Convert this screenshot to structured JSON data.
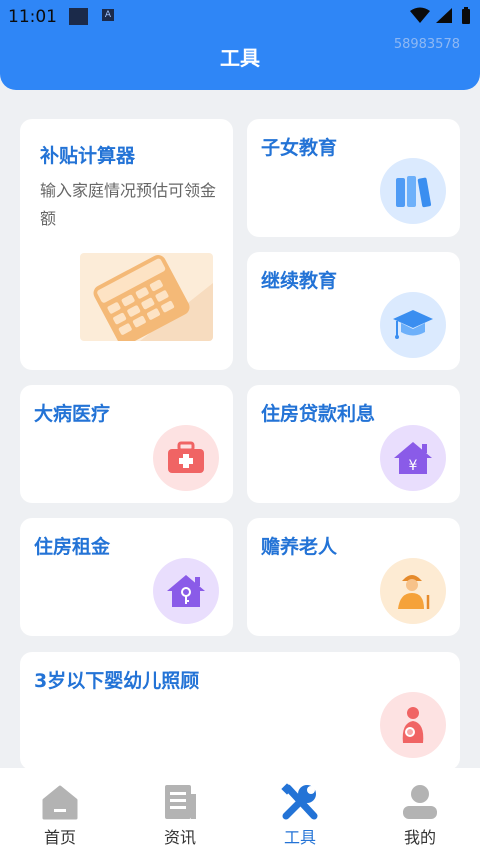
{
  "status": {
    "time": "11:01"
  },
  "header": {
    "title": "工具",
    "id": "58983578"
  },
  "cards": [
    {
      "title": "补贴计算器",
      "desc": "输入家庭情况预估可领金额",
      "icon": "calculator-icon"
    },
    {
      "title": "子女教育",
      "icon": "books-icon",
      "color": "#3a8ef0"
    },
    {
      "title": "继续教育",
      "icon": "graduation-cap-icon",
      "color": "#3a8ef0"
    },
    {
      "title": "大病医疗",
      "icon": "medical-kit-icon",
      "color": "#f05a5a"
    },
    {
      "title": "住房贷款利息",
      "icon": "house-yen-icon",
      "color": "#8a5be8"
    },
    {
      "title": "住房租金",
      "icon": "house-key-icon",
      "color": "#8a5be8"
    },
    {
      "title": "赡养老人",
      "icon": "elderly-person-icon",
      "color": "#f5a23a"
    },
    {
      "title": "3岁以下婴幼儿照顾",
      "icon": "mother-baby-icon",
      "color": "#f05a5a"
    }
  ],
  "tabbar": {
    "items": [
      {
        "label": "首页",
        "icon": "home-icon",
        "active": false
      },
      {
        "label": "资讯",
        "icon": "news-icon",
        "active": false
      },
      {
        "label": "工具",
        "icon": "tools-icon",
        "active": true
      },
      {
        "label": "我的",
        "icon": "profile-icon",
        "active": false
      }
    ]
  },
  "colors": {
    "primary": "#2f86f6",
    "title_text": "#2373d6",
    "background": "#eef0f3"
  }
}
